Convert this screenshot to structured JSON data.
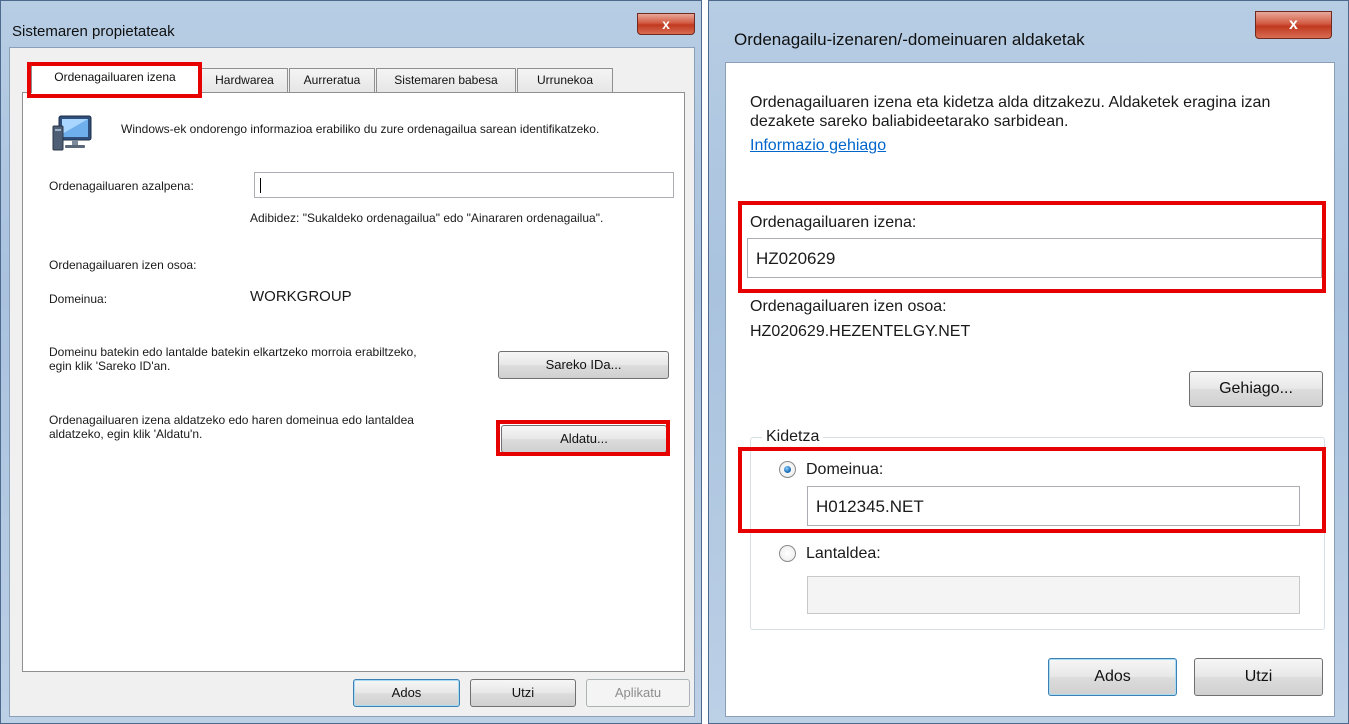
{
  "system_properties": {
    "title": "Sistemaren propietateak",
    "close_label": "x",
    "tabs": [
      {
        "label": "Ordenagailuaren izena",
        "active": true
      },
      {
        "label": "Hardwarea",
        "active": false
      },
      {
        "label": "Aurreratua",
        "active": false
      },
      {
        "label": "Sistemaren babesa",
        "active": false
      },
      {
        "label": "Urrunekoa",
        "active": false
      }
    ],
    "intro_text": "Windows-ek ondorengo informazioa erabiliko du zure ordenagailua sarean identifikatzeko.",
    "description_label": "Ordenagailuaren azalpena:",
    "description_value": "",
    "description_hint": "Adibidez: \"Sukaldeko ordenagailua\" edo \"Ainararen ordenagailua\".",
    "full_name_label": "Ordenagailuaren izen osoa:",
    "full_name_value": "",
    "domain_label": "Domeinua:",
    "domain_value": "WORKGROUP",
    "network_id_text": "Domeinu batekin edo lantalde batekin elkartzeko morroia erabiltzeko, egin klik 'Sareko ID'an.",
    "network_id_button": "Sareko IDa...",
    "change_text": "Ordenagailuaren izena aldatzeko edo haren domeinua edo lantaldea aldatzeko, egin klik 'Aldatu'n.",
    "change_button": "Aldatu...",
    "ok_button": "Ados",
    "cancel_button": "Utzi",
    "apply_button": "Aplikatu",
    "icon": "computer-monitor-icon"
  },
  "name_changes": {
    "title": "Ordenagailu-izenaren/-domeinuaren aldaketak",
    "close_label": "x",
    "intro_text": "Ordenagailuaren izena eta kidetza alda ditzakezu. Aldaketek eragina izan dezakete sareko baliabideetarako sarbidean.",
    "more_info_link": "Informazio gehiago",
    "computer_name_label": "Ordenagailuaren izena:",
    "computer_name_value": "HZ020629",
    "full_name_label": "Ordenagailuaren izen osoa:",
    "full_name_value": "HZ020629.HEZENTELGY.NET",
    "more_button": "Gehiago...",
    "membership_label": "Kidetza",
    "domain_option_label": "Domeinua:",
    "domain_value": "H012345.NET",
    "domain_selected": true,
    "workgroup_option_label": "Lantaldea:",
    "workgroup_value": "",
    "ok_button": "Ados",
    "cancel_button": "Utzi"
  },
  "colors": {
    "highlight": "#e60000",
    "link": "#0066cc",
    "titlebar": "#b7cde4",
    "close_button": "#c0391f"
  }
}
